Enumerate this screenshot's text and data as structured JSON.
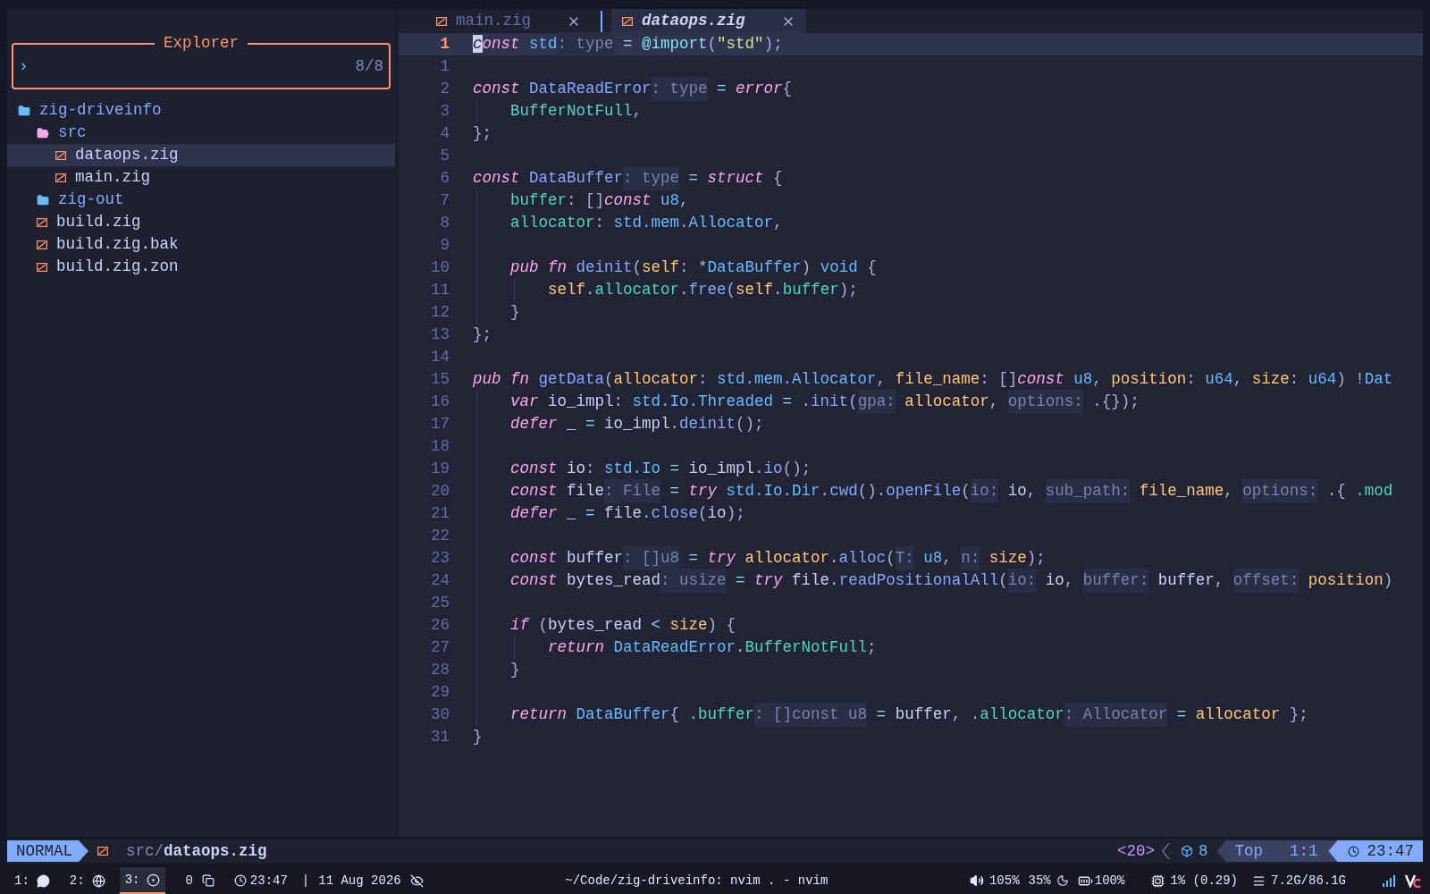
{
  "explorer": {
    "title": "Explorer",
    "prompt": "›",
    "count": "8/8"
  },
  "tree": [
    {
      "name": "zig-driveinfo",
      "kind": "root",
      "selected": false,
      "children": [
        {
          "name": "src",
          "kind": "folder",
          "expanded": true,
          "selected": false,
          "children": [
            {
              "name": "dataops.zig",
              "kind": "file",
              "selected": true
            },
            {
              "name": "main.zig",
              "kind": "file",
              "selected": false
            }
          ]
        },
        {
          "name": "zig-out",
          "kind": "folder",
          "expanded": false,
          "selected": false
        },
        {
          "name": "build.zig",
          "kind": "file",
          "selected": false
        },
        {
          "name": "build.zig.bak",
          "kind": "file",
          "selected": false
        },
        {
          "name": "build.zig.zon",
          "kind": "file",
          "selected": false
        }
      ]
    }
  ],
  "tabs": [
    {
      "label": "main.zig",
      "selected": false
    },
    {
      "label": "dataops.zig",
      "selected": true
    }
  ],
  "lines": [
    {
      "n": "1",
      "selected": true,
      "tokens": [
        {
          "kind": "kw",
          "text": "const "
        },
        {
          "kind": "type",
          "text": "std"
        },
        {
          "kind": "hint",
          "text": ": type"
        },
        {
          "kind": "op",
          "text": " = "
        },
        {
          "kind": "builtin",
          "text": "@import"
        },
        {
          "kind": "punct",
          "text": "("
        },
        {
          "kind": "str",
          "text": "\"std\""
        },
        {
          "kind": "punct",
          "text": ");"
        }
      ]
    },
    {
      "n": "1",
      "selected": false
    },
    {
      "n": "2",
      "selected": false,
      "tokens": [
        {
          "kind": "kw",
          "text": "const "
        },
        {
          "kind": "fn",
          "text": "DataReadError"
        },
        {
          "kind": "hint",
          "text": ": type"
        },
        {
          "kind": "op",
          "text": " = "
        },
        {
          "kind": "kw",
          "text": "error"
        },
        {
          "kind": "punct",
          "text": "{"
        }
      ]
    },
    {
      "n": "3",
      "selected": false,
      "tokens": [
        {
          "kind": "field",
          "text": "    BufferNotFull"
        },
        {
          "kind": "punct",
          "text": ","
        }
      ]
    },
    {
      "n": "4",
      "selected": false,
      "tokens": [
        {
          "kind": "punct",
          "text": "};"
        }
      ]
    },
    {
      "n": "5",
      "selected": false
    },
    {
      "n": "6",
      "selected": false,
      "tokens": [
        {
          "kind": "kw",
          "text": "const "
        },
        {
          "kind": "fn",
          "text": "DataBuffer"
        },
        {
          "kind": "hint",
          "text": ": type"
        },
        {
          "kind": "op",
          "text": " = "
        },
        {
          "kind": "kw",
          "text": "struct"
        },
        {
          "kind": "punct",
          "text": " {"
        }
      ]
    },
    {
      "n": "7",
      "selected": false,
      "tokens": [
        {
          "kind": "field",
          "text": "    buffer"
        },
        {
          "kind": "punct",
          "text": ": []"
        },
        {
          "kind": "kw",
          "text": "const"
        },
        {
          "kind": "type",
          "text": " u8"
        },
        {
          "kind": "punct",
          "text": ","
        }
      ]
    },
    {
      "n": "8",
      "selected": false,
      "tokens": [
        {
          "kind": "field",
          "text": "    allocator"
        },
        {
          "kind": "punct",
          "text": ": "
        },
        {
          "kind": "type",
          "text": "std.mem.Allocator"
        },
        {
          "kind": "punct",
          "text": ","
        }
      ]
    },
    {
      "n": "9",
      "selected": false
    },
    {
      "n": "10",
      "selected": false,
      "tokens": [
        {
          "kind": "kw",
          "text": "    pub fn "
        },
        {
          "kind": "fn",
          "text": "deinit"
        },
        {
          "kind": "punct",
          "text": "("
        },
        {
          "kind": "param",
          "text": "self"
        },
        {
          "kind": "punct",
          "text": ": *"
        },
        {
          "kind": "type",
          "text": "DataBuffer"
        },
        {
          "kind": "punct",
          "text": ") "
        },
        {
          "kind": "type",
          "text": "void"
        },
        {
          "kind": "punct",
          "text": " {"
        }
      ]
    },
    {
      "n": "11",
      "selected": false,
      "tokens": [
        {
          "kind": "param",
          "text": "        self"
        },
        {
          "kind": "punct",
          "text": "."
        },
        {
          "kind": "field",
          "text": "allocator"
        },
        {
          "kind": "punct",
          "text": "."
        },
        {
          "kind": "fn",
          "text": "free"
        },
        {
          "kind": "punct",
          "text": "("
        },
        {
          "kind": "param",
          "text": "self"
        },
        {
          "kind": "punct",
          "text": "."
        },
        {
          "kind": "field",
          "text": "buffer"
        },
        {
          "kind": "punct",
          "text": ");"
        }
      ]
    },
    {
      "n": "12",
      "selected": false,
      "tokens": [
        {
          "kind": "punct",
          "text": "    }"
        }
      ]
    },
    {
      "n": "13",
      "selected": false,
      "tokens": [
        {
          "kind": "punct",
          "text": "};"
        }
      ]
    },
    {
      "n": "14",
      "selected": false
    },
    {
      "n": "15",
      "selected": false,
      "tokens": [
        {
          "kind": "kw",
          "text": "pub fn "
        },
        {
          "kind": "fn",
          "text": "getData"
        },
        {
          "kind": "punct",
          "text": "("
        },
        {
          "kind": "param",
          "text": "allocator"
        },
        {
          "kind": "punct",
          "text": ": "
        },
        {
          "kind": "type",
          "text": "std.mem.Allocator"
        },
        {
          "kind": "punct",
          "text": ", "
        },
        {
          "kind": "param",
          "text": "file_name"
        },
        {
          "kind": "punct",
          "text": ": []"
        },
        {
          "kind": "kw",
          "text": "const"
        },
        {
          "kind": "type",
          "text": " u8"
        },
        {
          "kind": "punct",
          "text": ", "
        },
        {
          "kind": "param",
          "text": "position"
        },
        {
          "kind": "punct",
          "text": ": "
        },
        {
          "kind": "type",
          "text": "u64"
        },
        {
          "kind": "punct",
          "text": ", "
        },
        {
          "kind": "param",
          "text": "size"
        },
        {
          "kind": "punct",
          "text": ": "
        },
        {
          "kind": "type",
          "text": "u64"
        },
        {
          "kind": "punct",
          "text": ") !"
        },
        {
          "kind": "type",
          "text": "Dat"
        }
      ]
    },
    {
      "n": "16",
      "selected": false,
      "tokens": [
        {
          "kind": "kw",
          "text": "    var "
        },
        {
          "kind": "var",
          "text": "io_impl"
        },
        {
          "kind": "punct",
          "text": ": "
        },
        {
          "kind": "type",
          "text": "std.Io.Threaded"
        },
        {
          "kind": "op",
          "text": " = "
        },
        {
          "kind": "punct",
          "text": "."
        },
        {
          "kind": "fn",
          "text": "init"
        },
        {
          "kind": "punct",
          "text": "("
        },
        {
          "kind": "hint",
          "text": "gpa:"
        },
        {
          "kind": "param",
          "text": " allocator"
        },
        {
          "kind": "punct",
          "text": ", "
        },
        {
          "kind": "hint",
          "text": "options:"
        },
        {
          "kind": "punct",
          "text": " .{});"
        }
      ]
    },
    {
      "n": "17",
      "selected": false,
      "tokens": [
        {
          "kind": "kw",
          "text": "    defer "
        },
        {
          "kind": "var",
          "text": "_"
        },
        {
          "kind": "op",
          "text": " = "
        },
        {
          "kind": "var",
          "text": "io_impl"
        },
        {
          "kind": "punct",
          "text": "."
        },
        {
          "kind": "fn",
          "text": "deinit"
        },
        {
          "kind": "punct",
          "text": "();"
        }
      ]
    },
    {
      "n": "18",
      "selected": false
    },
    {
      "n": "19",
      "selected": false,
      "tokens": [
        {
          "kind": "kw",
          "text": "    const "
        },
        {
          "kind": "var",
          "text": "io"
        },
        {
          "kind": "punct",
          "text": ": "
        },
        {
          "kind": "type",
          "text": "std.Io"
        },
        {
          "kind": "op",
          "text": " = "
        },
        {
          "kind": "var",
          "text": "io_impl"
        },
        {
          "kind": "punct",
          "text": "."
        },
        {
          "kind": "fn",
          "text": "io"
        },
        {
          "kind": "punct",
          "text": "();"
        }
      ]
    },
    {
      "n": "20",
      "selected": false,
      "tokens": [
        {
          "kind": "kw",
          "text": "    const "
        },
        {
          "kind": "var",
          "text": "file"
        },
        {
          "kind": "hint",
          "text": ": File"
        },
        {
          "kind": "op",
          "text": " = "
        },
        {
          "kind": "kw",
          "text": "try "
        },
        {
          "kind": "type",
          "text": "std.Io.Dir"
        },
        {
          "kind": "punct",
          "text": "."
        },
        {
          "kind": "fn",
          "text": "cwd"
        },
        {
          "kind": "punct",
          "text": "()."
        },
        {
          "kind": "fn",
          "text": "openFile"
        },
        {
          "kind": "punct",
          "text": "("
        },
        {
          "kind": "hint",
          "text": "io:"
        },
        {
          "kind": "var",
          "text": " io"
        },
        {
          "kind": "punct",
          "text": ", "
        },
        {
          "kind": "hint",
          "text": "sub_path:"
        },
        {
          "kind": "param",
          "text": " file_name"
        },
        {
          "kind": "punct",
          "text": ", "
        },
        {
          "kind": "hint",
          "text": "options:"
        },
        {
          "kind": "punct",
          "text": " .{ "
        },
        {
          "kind": "field",
          "text": ".mod"
        }
      ]
    },
    {
      "n": "21",
      "selected": false,
      "tokens": [
        {
          "kind": "kw",
          "text": "    defer "
        },
        {
          "kind": "var",
          "text": "_"
        },
        {
          "kind": "op",
          "text": " = "
        },
        {
          "kind": "var",
          "text": "file"
        },
        {
          "kind": "punct",
          "text": "."
        },
        {
          "kind": "fn",
          "text": "close"
        },
        {
          "kind": "punct",
          "text": "("
        },
        {
          "kind": "var",
          "text": "io"
        },
        {
          "kind": "punct",
          "text": ");"
        }
      ]
    },
    {
      "n": "22",
      "selected": false
    },
    {
      "n": "23",
      "selected": false,
      "tokens": [
        {
          "kind": "kw",
          "text": "    const "
        },
        {
          "kind": "var",
          "text": "buffer"
        },
        {
          "kind": "hint",
          "text": ": []u8"
        },
        {
          "kind": "op",
          "text": " = "
        },
        {
          "kind": "kw",
          "text": "try "
        },
        {
          "kind": "param",
          "text": "allocator"
        },
        {
          "kind": "punct",
          "text": "."
        },
        {
          "kind": "fn",
          "text": "alloc"
        },
        {
          "kind": "punct",
          "text": "("
        },
        {
          "kind": "hint",
          "text": "T:"
        },
        {
          "kind": "type",
          "text": " u8"
        },
        {
          "kind": "punct",
          "text": ", "
        },
        {
          "kind": "hint",
          "text": "n:"
        },
        {
          "kind": "param",
          "text": " size"
        },
        {
          "kind": "punct",
          "text": ");"
        }
      ]
    },
    {
      "n": "24",
      "selected": false,
      "tokens": [
        {
          "kind": "kw",
          "text": "    const "
        },
        {
          "kind": "var",
          "text": "bytes_read"
        },
        {
          "kind": "hint",
          "text": ": usize"
        },
        {
          "kind": "op",
          "text": " = "
        },
        {
          "kind": "kw",
          "text": "try "
        },
        {
          "kind": "var",
          "text": "file"
        },
        {
          "kind": "punct",
          "text": "."
        },
        {
          "kind": "fn",
          "text": "readPositionalAll"
        },
        {
          "kind": "punct",
          "text": "("
        },
        {
          "kind": "hint",
          "text": "io:"
        },
        {
          "kind": "var",
          "text": " io"
        },
        {
          "kind": "punct",
          "text": ", "
        },
        {
          "kind": "hint",
          "text": "buffer:"
        },
        {
          "kind": "var",
          "text": " buffer"
        },
        {
          "kind": "punct",
          "text": ", "
        },
        {
          "kind": "hint",
          "text": "offset:"
        },
        {
          "kind": "param",
          "text": " position"
        },
        {
          "kind": "punct",
          "text": ")"
        }
      ]
    },
    {
      "n": "25",
      "selected": false
    },
    {
      "n": "26",
      "selected": false,
      "tokens": [
        {
          "kind": "kw",
          "text": "    if "
        },
        {
          "kind": "punct",
          "text": "("
        },
        {
          "kind": "var",
          "text": "bytes_read"
        },
        {
          "kind": "op",
          "text": " < "
        },
        {
          "kind": "param",
          "text": "size"
        },
        {
          "kind": "punct",
          "text": ") {"
        }
      ]
    },
    {
      "n": "27",
      "selected": false,
      "tokens": [
        {
          "kind": "kw",
          "text": "        return "
        },
        {
          "kind": "type",
          "text": "DataReadError"
        },
        {
          "kind": "punct",
          "text": "."
        },
        {
          "kind": "field",
          "text": "BufferNotFull"
        },
        {
          "kind": "punct",
          "text": ";"
        }
      ]
    },
    {
      "n": "28",
      "selected": false,
      "tokens": [
        {
          "kind": "punct",
          "text": "    }"
        }
      ]
    },
    {
      "n": "29",
      "selected": false
    },
    {
      "n": "30",
      "selected": false,
      "tokens": [
        {
          "kind": "kw",
          "text": "    return "
        },
        {
          "kind": "type",
          "text": "DataBuffer"
        },
        {
          "kind": "punct",
          "text": "{ "
        },
        {
          "kind": "field",
          "text": ".buffer"
        },
        {
          "kind": "hint",
          "text": ": []const u8"
        },
        {
          "kind": "op",
          "text": " = "
        },
        {
          "kind": "var",
          "text": "buffer"
        },
        {
          "kind": "punct",
          "text": ", "
        },
        {
          "kind": "field",
          "text": ".allocator"
        },
        {
          "kind": "hint",
          "text": ": Allocator"
        },
        {
          "kind": "op",
          "text": " = "
        },
        {
          "kind": "param",
          "text": "allocator"
        },
        {
          "kind": "punct",
          "text": " };"
        }
      ]
    },
    {
      "n": "31",
      "selected": false,
      "tokens": [
        {
          "kind": "punct",
          "text": "}"
        }
      ]
    }
  ],
  "statusline": {
    "mode": "NORMAL",
    "path_dir": "src/",
    "path_file": "dataops.zig",
    "register": "<20>",
    "count": "8",
    "position": "Top",
    "cursor": "1:1",
    "time": "23:47"
  },
  "bar": {
    "workspaces": [
      {
        "label": "1:",
        "kind": "chat",
        "selected": false
      },
      {
        "label": "2:",
        "kind": "globe",
        "selected": false
      },
      {
        "label": "3:",
        "kind": "record",
        "selected": true
      }
    ],
    "windows": "0",
    "clock": "23:47",
    "separator": "|",
    "date": "11 Aug 2026",
    "title": "~/Code/zig-driveinfo: nvim . - nvim",
    "volume": "105%",
    "brightness": "35%",
    "battery": "100%",
    "cpu": "1% (0.29)",
    "memory": "7.2G/86.1G"
  }
}
